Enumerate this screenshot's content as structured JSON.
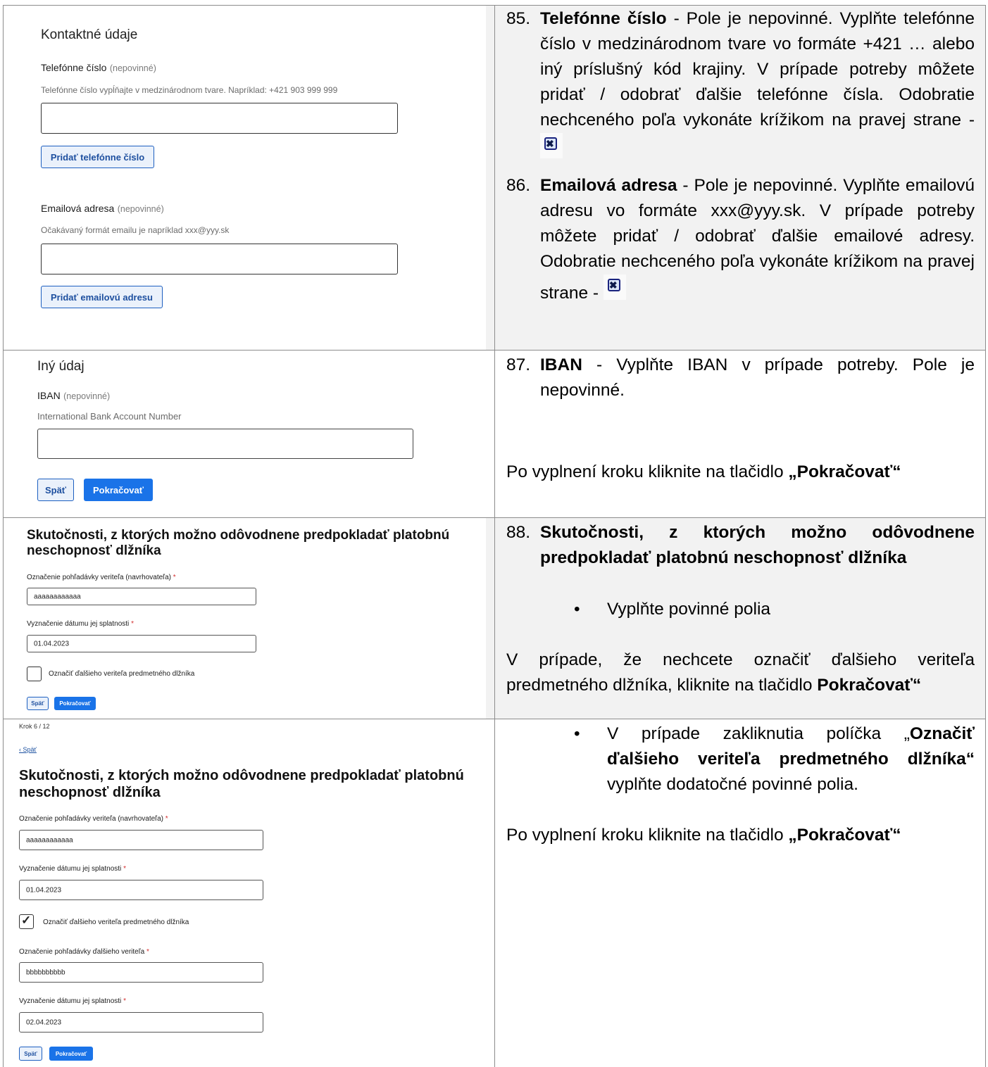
{
  "rows": [
    {
      "form": {
        "section_title": "Kontaktné údaje",
        "phone_label": "Telefónne číslo",
        "optional": "(nepovinné)",
        "phone_hint": "Telefónne číslo vypĺňajte v medzinárodnom tvare. Napríklad: +421 903 999 999",
        "add_phone_button": "Pridať telefónne číslo",
        "email_label": "Emailová adresa",
        "email_hint": "Očakávaný formát emailu je napríklad xxx@yyy.sk",
        "add_email_button": "Pridať emailovú adresu"
      },
      "notes": [
        {
          "number": "85.",
          "title": "Telefónne číslo",
          "text": " - Pole je nepovinné. Vyplňte telefónne číslo v medzinárodnom tvare vo formáte +421 … alebo iný príslušný kód krajiny. V prípade potreby môžete pridať / odobrať ďalšie telefónne čísla. Odobratie nechceného poľa vykonáte krížikom na pravej strane -"
        },
        {
          "number": "86.",
          "title": "Emailová adresa",
          "text": " - Pole je nepovinné. Vyplňte emailovú adresu vo formáte xxx@yyy.sk. V prípade potreby môžete pridať / odobrať ďalšie emailové adresy. Odobratie nechceného poľa vykonáte krížikom na pravej strane -"
        }
      ]
    },
    {
      "form": {
        "section_title": "Iný údaj",
        "iban_label": "IBAN",
        "optional": "(nepovinné)",
        "iban_hint": "International Bank Account Number",
        "back_button": "Späť",
        "continue_button": "Pokračovať"
      },
      "notes": [
        {
          "number": "87.",
          "title": "IBAN",
          "text": " - Vyplňte IBAN v prípade potreby. Pole je nepovinné."
        }
      ],
      "footer_text": "Po vyplnení kroku kliknite na tlačidlo ",
      "footer_bold": "„Pokračovať“"
    },
    {
      "form": {
        "heading": "Skutočnosti, z ktorých možno odôvodnene predpokladať platobnú neschopnosť dlžníka",
        "claim_label": "Označenie pohľadávky veriteľa (navrhovateľa)",
        "claim_value": "aaaaaaaaaaaa",
        "date_label": "Vyznačenie dátumu jej splatnosti",
        "date_value": "01.04.2023",
        "checkbox_label": "Označiť ďalšieho veriteľa predmetného dlžníka",
        "checkbox_checked": false,
        "back_button": "Späť",
        "continue_button": "Pokračovať"
      },
      "notes": [
        {
          "number": "88.",
          "title": "Skutočnosti, z ktorých možno odôvodnene predpokladať platobnú neschopnosť dlžníka"
        }
      ],
      "bullet": "Vyplňte povinné polia",
      "footer_text": "V prípade, že nechcete označiť ďalšieho veriteľa predmetného dlžníka, kliknite na tlačidlo ",
      "footer_bold": "Pokračovať“"
    },
    {
      "form": {
        "step": "Krok 6 / 12",
        "back_link": "‹ Späť",
        "heading": "Skutočnosti, z ktorých možno odôvodnene predpokladať platobnú neschopnosť dlžníka",
        "claim_label": "Označenie pohľadávky veriteľa (navrhovateľa)",
        "claim_value": "aaaaaaaaaaaa",
        "date_label": "Vyznačenie dátumu jej splatnosti",
        "date_value": "01.04.2023",
        "checkbox_label": "Označiť ďalšieho veriteľa predmetného dlžníka",
        "checkbox_checked": true,
        "claim2_label": "Označenie pohľadávky ďalšieho veriteľa",
        "claim2_value": "bbbbbbbbbb",
        "date2_label": "Vyznačenie dátumu jej splatnosti",
        "date2_value": "02.04.2023",
        "back_button": "Späť",
        "continue_button": "Pokračovať"
      },
      "bullet_pre": "V prípade zakliknutia políčka „",
      "bullet_bold": "Označiť ďalšieho veriteľa predmetného dlžníka“",
      "bullet_post": " vyplňte dodatočné povinné polia.",
      "footer_text": "Po vyplnení kroku kliknite na tlačidlo ",
      "footer_bold": "„Pokračovať“"
    }
  ],
  "required_mark": "*",
  "close_icon_glyph": "✖",
  "check_glyph": "✓",
  "bullet_glyph": "•"
}
